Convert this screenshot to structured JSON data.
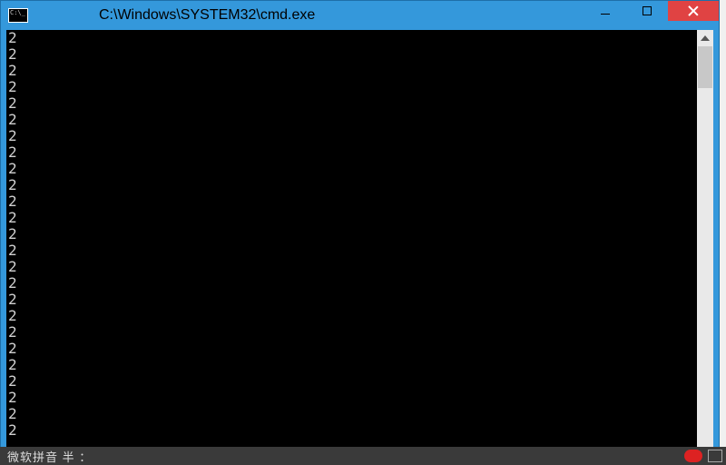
{
  "titlebar": {
    "title": "C:\\Windows\\SYSTEM32\\cmd.exe"
  },
  "terminal": {
    "lines": [
      "2",
      "2",
      "2",
      "2",
      "2",
      "2",
      "2",
      "2",
      "2",
      "2",
      "2",
      "2",
      "2",
      "2",
      "2",
      "2",
      "2",
      "2",
      "2",
      "2",
      "2",
      "2",
      "2",
      "2",
      "2"
    ]
  },
  "ime": {
    "label": "微软拼音  半  ："
  },
  "colors": {
    "titlebar": "#3498db",
    "close": "#e04343",
    "terminal_bg": "#000000",
    "terminal_fg": "#d0d0d0"
  }
}
